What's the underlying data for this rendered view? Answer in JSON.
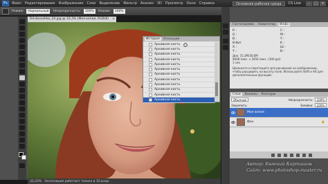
{
  "app": {
    "logo": "Ps",
    "menu": [
      "Файл",
      "Редактирование",
      "Изображение",
      "Слои",
      "Выделение",
      "Фильтр",
      "Анализ",
      "3D",
      "Просмотр",
      "Окно",
      "Справка"
    ],
    "workspace": "Основная рабочая среда",
    "cs_live": "CS Live"
  },
  "options": {
    "mode_label": "Режим:",
    "mode_value": "Нормальный",
    "opacity_label": "Непрозрачность:",
    "opacity_value": "100%",
    "flow_label": "Нажим:",
    "flow_value": "100%"
  },
  "document": {
    "tab_title": "Rd-devushka_10.jpg @ 33,3% (Моя копия, RGB/8)",
    "tab_close": "×",
    "status_zoom": "33,33%",
    "status_info": "Экспозиция работает только в 32-разр."
  },
  "history": {
    "tab_active": "История",
    "tab_inactive": "Операции",
    "items": [
      "Архивная кисть",
      "Архивная кисть",
      "Архивная кисть",
      "Архивная кисть",
      "Архивная кисть",
      "Архивная кисть",
      "Архивная кисть",
      "Архивная кисть",
      "Архивная кисть",
      "Архивная кисть",
      "Архивная кисть",
      "Архивная кисть"
    ],
    "selected_index": 11
  },
  "info_panel": {
    "tabs": [
      "Гистограмма",
      "Навигатор",
      "Инфо"
    ],
    "active_tab": 2,
    "left_block": [
      "R :",
      "G :",
      "B :",
      "8-бит"
    ],
    "right_block": [
      "C :",
      "M :",
      "Y :",
      "K :",
      "8-бит"
    ],
    "xy": [
      "X :",
      "Y :"
    ],
    "wh": [
      "Ш :",
      "В :"
    ],
    "doc_lines": [
      "Док: 15,3M/30,6M",
      "4608 пикс. x 3456 пикс. (300 ppi)",
      "1 сек",
      "Удерживает выделение",
      "Нажмите на цвете...",
      "Щелкните и перетащите, чтобы...",
      "расширить..."
    ],
    "help_text": "Щелкните и перетащите для рисования на изображении, чтобы расширить на высоту поля. Используйте Shift и Alt для дополнительных функций."
  },
  "layers": {
    "tabs": [
      "Слои",
      "Каналы",
      "Контуры"
    ],
    "blend_mode": "Обычные",
    "opacity_label": "Непрозрачность:",
    "opacity_value": "100%",
    "lock_label": "Закрепить:",
    "fill_label": "Заливка:",
    "fill_value": "100%",
    "items": [
      {
        "name": "Моя копия",
        "selected": true
      },
      {
        "name": "Фон",
        "selected": false
      }
    ]
  },
  "watermark": {
    "line1": "Автор: Евгений Карташов",
    "line2": "Сайт: www.photoshop-master.ru"
  }
}
